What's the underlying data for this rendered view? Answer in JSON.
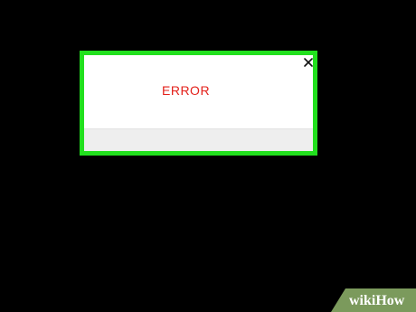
{
  "dialog": {
    "message": "ERROR",
    "close_glyph": "×",
    "border_color": "#22e01e",
    "message_color": "#e3211b"
  },
  "watermark": {
    "brand": "wikiHow",
    "brand_part1": "wiki",
    "brand_part2": "How",
    "background_color": "#7b9a5c"
  },
  "icons": {
    "close": "close-icon"
  }
}
